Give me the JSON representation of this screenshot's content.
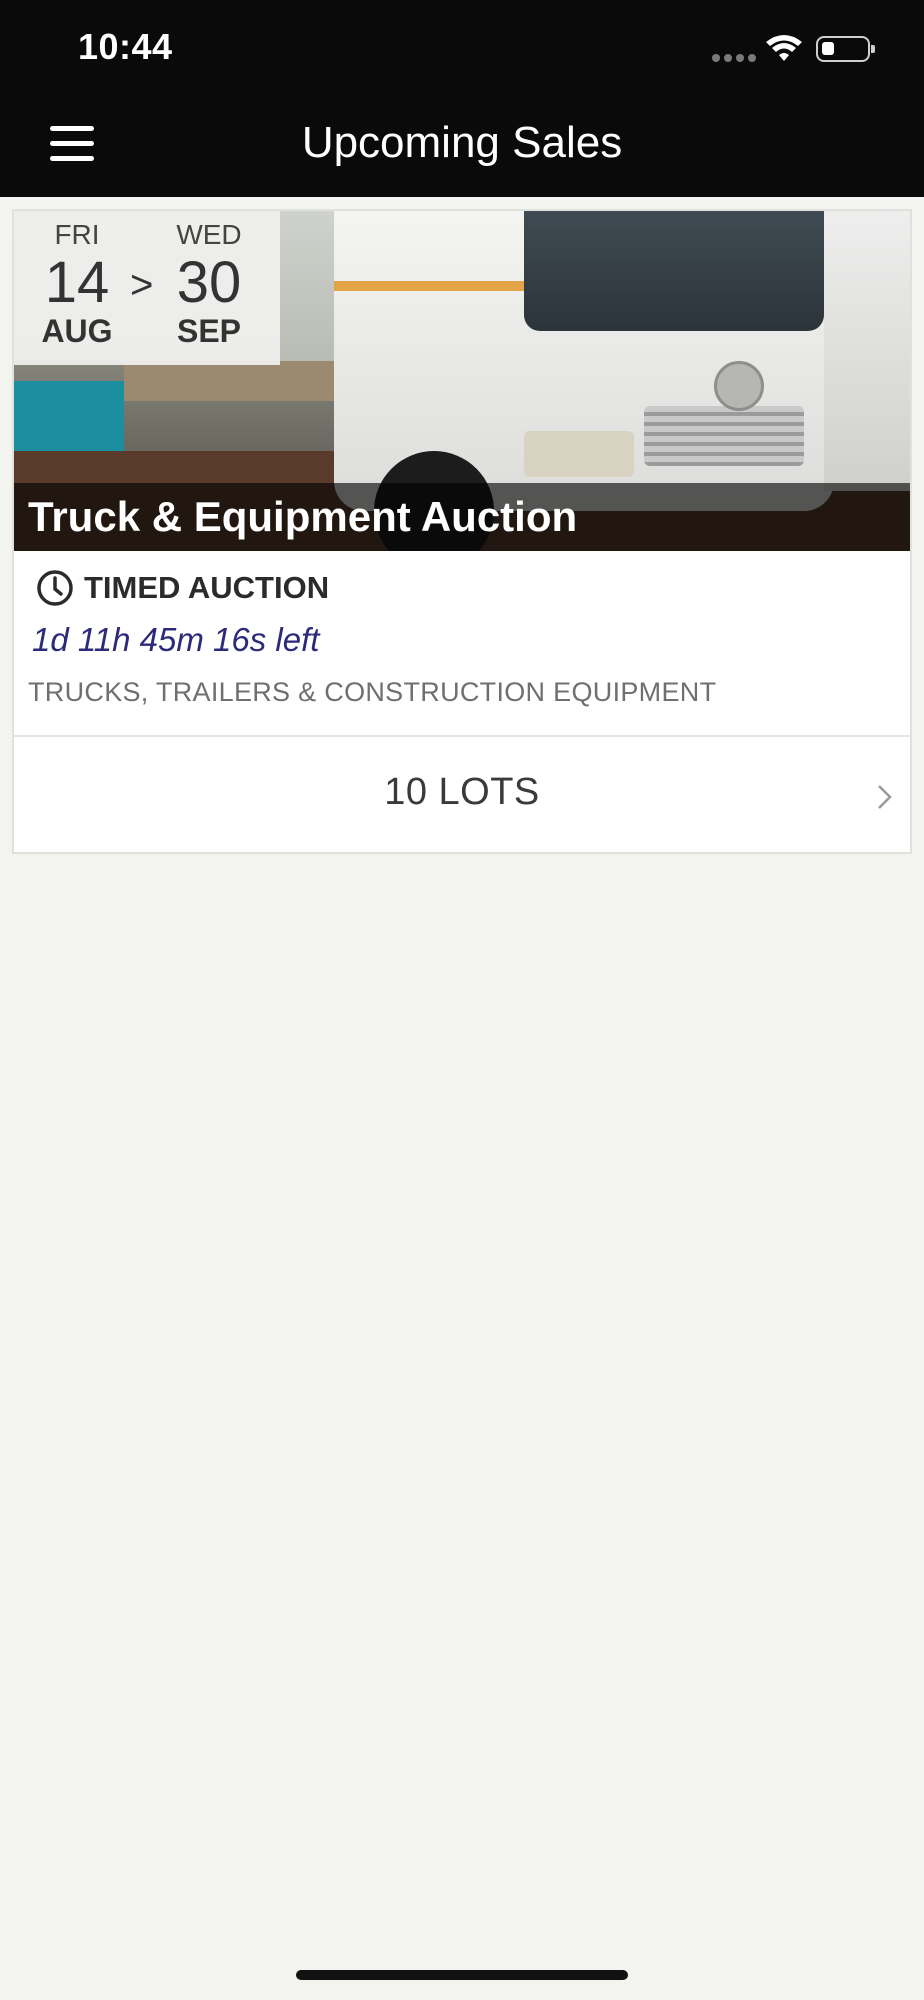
{
  "status_bar": {
    "time": "10:44",
    "icons": [
      "signal-icon",
      "wifi-icon",
      "battery-icon"
    ]
  },
  "header": {
    "title": "Upcoming Sales",
    "menu_icon": "hamburger-menu-icon"
  },
  "sale": {
    "dates": {
      "start": {
        "day": "FRI",
        "date": "14",
        "month": "AUG"
      },
      "separator": ">",
      "end": {
        "day": "WED",
        "date": "30",
        "month": "SEP"
      }
    },
    "title": "Truck & Equipment Auction",
    "type_label": "TIMED AUCTION",
    "type_icon": "clock-icon",
    "countdown": "1d 11h 45m 16s left",
    "category": "TRUCKS, TRAILERS & CONSTRUCTION EQUIPMENT",
    "lots_label": "10 LOTS",
    "lots_icon": "chevron-right-icon"
  },
  "colors": {
    "header_bg": "#0a0a0a",
    "page_bg": "#f3f3ef",
    "countdown_text": "#2d2a7a"
  }
}
